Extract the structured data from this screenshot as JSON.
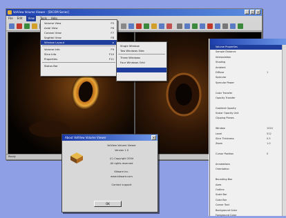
{
  "window": {
    "title": "VolView Volume Viewer - [DICOM Series]"
  },
  "window_buttons": [
    "_",
    "□",
    "×"
  ],
  "menubar": {
    "items": [
      "File",
      "Edit",
      "View",
      "Tools",
      "Help"
    ]
  },
  "toolbar_colors": [
    "#5a7bc4",
    "#c0392b",
    "#3b8a3b",
    "#d2a02a",
    "#777777",
    "#5a7bc4",
    "#c0392b",
    "#3b8a3b",
    "#5a7bc4",
    "#aa4444",
    "#3b6fcc",
    "#c0392b",
    "#2c8f7a",
    "#5a7bc4",
    "#888888",
    "#5a7bc4",
    "#c0392b",
    "#3b8a3b",
    "#d2a02a",
    "#5a7bc4",
    "#c05050",
    "#777777",
    "#5a7bc4",
    "#3b8a3b",
    "#5a7bc4",
    "#c0392b",
    "#5a7bc4",
    "#777777",
    "#5a7bc4",
    "#3b8a3b"
  ],
  "status": {
    "left": "Ready",
    "right": "Ready"
  },
  "view_menu": {
    "items": [
      {
        "label": "Volume View",
        "key": "F5"
      },
      {
        "label": "Axial View",
        "key": "F6"
      },
      {
        "label": "Coronal View",
        "key": "F7"
      },
      {
        "label": "Sagittal View",
        "key": "F8"
      },
      {
        "label": "Window Layout",
        "key": "",
        "selected": true
      },
      {
        "label": "Volume Info",
        "key": "F9"
      },
      {
        "label": "Slice Info",
        "key": "F10"
      },
      {
        "label": "Properties",
        "key": "F11"
      },
      {
        "label": "Status Bar",
        "key": ""
      }
    ]
  },
  "sub_menu": {
    "items": [
      {
        "label": "Single Window",
        "selected": false
      },
      {
        "label": "Two Windows Side",
        "selected": false
      },
      {
        "label": "Three Windows",
        "selected": false
      },
      {
        "label": "Four Windows Grid",
        "selected": false
      },
      {
        "label": "",
        "selected": true
      }
    ]
  },
  "properties": {
    "rows": [
      {
        "label": "Volume Properties",
        "value": "",
        "selected": true
      },
      {
        "label": "Sample Distance",
        "value": ""
      },
      {
        "label": "Interpolation",
        "value": ""
      },
      {
        "label": "Shading",
        "value": ""
      },
      {
        "label": "Ambient",
        "value": ""
      },
      {
        "label": "Diffuse",
        "value": "1"
      },
      {
        "label": "Specular",
        "value": ""
      },
      {
        "label": "Specular Power",
        "value": ""
      },
      {
        "label": "",
        "value": ""
      },
      {
        "label": "Color Transfer",
        "value": ""
      },
      {
        "label": "Opacity Transfer",
        "value": ""
      },
      {
        "label": "",
        "value": ""
      },
      {
        "label": "Gradient Opacity",
        "value": ""
      },
      {
        "label": "Scalar Opacity Unit",
        "value": ""
      },
      {
        "label": "Clipping Planes",
        "value": ""
      },
      {
        "label": "",
        "value": ""
      },
      {
        "label": "Window",
        "value": "1024"
      },
      {
        "label": "Level",
        "value": "512"
      },
      {
        "label": "Slice Thickness",
        "value": "0.5"
      },
      {
        "label": "Zoom",
        "value": "1.0"
      },
      {
        "label": "",
        "value": ""
      },
      {
        "label": "Cursor Position",
        "value": "0"
      },
      {
        "label": "",
        "value": ""
      },
      {
        "label": "Annotations",
        "value": ""
      },
      {
        "label": "Orientation",
        "value": ""
      },
      {
        "label": "",
        "value": ""
      },
      {
        "label": "Bounding Box",
        "value": ""
      },
      {
        "label": "Axes",
        "value": ""
      },
      {
        "label": "Outline",
        "value": ""
      },
      {
        "label": "Scale Bar",
        "value": ""
      },
      {
        "label": "Color Bar",
        "value": ""
      },
      {
        "label": "Corner Text",
        "value": ""
      },
      {
        "label": "Background Color",
        "value": ""
      },
      {
        "label": "Foreground Color",
        "value": ""
      }
    ]
  },
  "about": {
    "title": "About VolView Volume Viewer",
    "lines": [
      "VolView Volume Viewer",
      "Version 1.0",
      "",
      "(C) Copyright 2004",
      "All rights reserved",
      "",
      "Kitware Inc.",
      "www.kitware.com",
      "",
      "Contact support"
    ],
    "ok_label": "OK"
  }
}
